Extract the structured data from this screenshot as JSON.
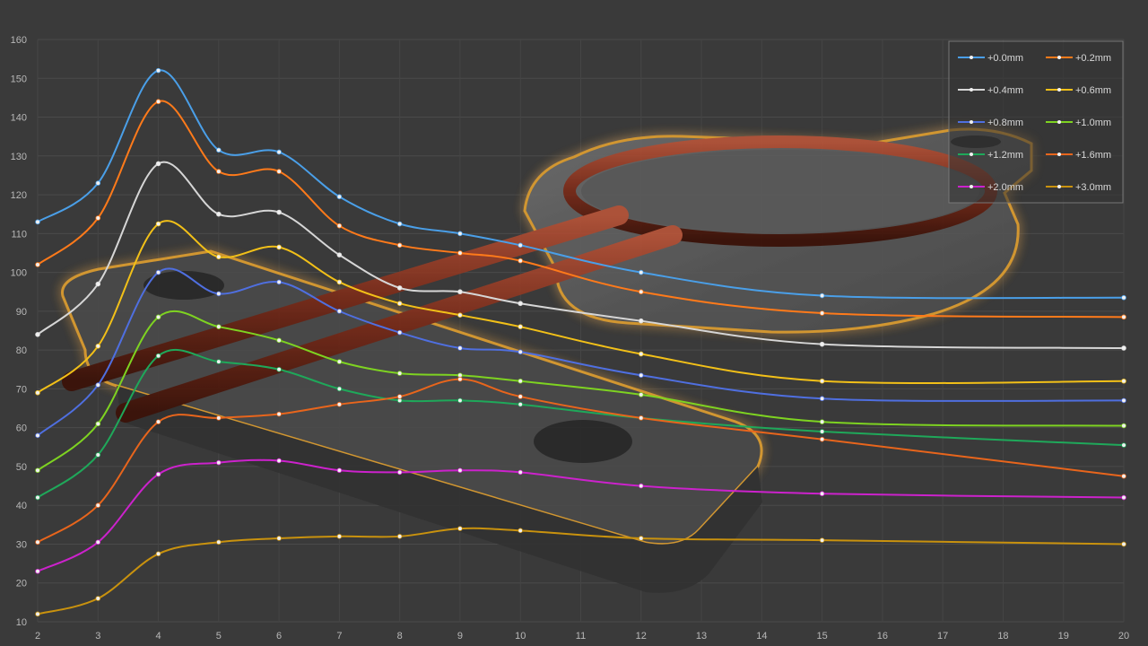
{
  "chart_data": {
    "type": "line",
    "x": [
      2,
      3,
      4,
      5,
      6,
      7,
      8,
      9,
      10,
      11,
      12,
      13,
      14,
      15,
      16,
      17,
      18,
      19,
      20
    ],
    "ylim": [
      10,
      160
    ],
    "xlim": [
      2,
      20
    ],
    "yticks": [
      10,
      20,
      30,
      40,
      50,
      60,
      70,
      80,
      90,
      100,
      110,
      120,
      130,
      140,
      150,
      160
    ],
    "xticks": [
      2,
      3,
      4,
      5,
      6,
      7,
      8,
      9,
      10,
      11,
      12,
      13,
      14,
      15,
      16,
      17,
      18,
      19,
      20
    ],
    "grid": true,
    "legend_position": "top-right",
    "series": [
      {
        "name": "+0.0mm",
        "color": "#4a9fe8",
        "x": [
          2,
          3,
          4,
          5,
          6,
          7,
          8,
          9,
          10,
          12,
          15,
          20
        ],
        "values": [
          113,
          123,
          152,
          131.5,
          131,
          119.5,
          112.5,
          110,
          107,
          100,
          94,
          93.5
        ]
      },
      {
        "name": "+0.2mm",
        "color": "#ff7a1a",
        "x": [
          2,
          3,
          4,
          5,
          6,
          7,
          8,
          9,
          10,
          12,
          15,
          20
        ],
        "values": [
          102,
          114,
          144,
          126,
          126,
          112,
          107,
          105,
          103,
          95,
          89.5,
          88.5
        ]
      },
      {
        "name": "+0.4mm",
        "color": "#d6d6d6",
        "x": [
          2,
          3,
          4,
          5,
          6,
          7,
          8,
          9,
          10,
          12,
          15,
          20
        ],
        "values": [
          84,
          97,
          128,
          115,
          115.5,
          104.5,
          96,
          95,
          92,
          87.5,
          81.5,
          80.5
        ]
      },
      {
        "name": "+0.6mm",
        "color": "#f2c018",
        "x": [
          2,
          3,
          4,
          5,
          6,
          7,
          8,
          9,
          10,
          12,
          15,
          20
        ],
        "values": [
          69,
          81,
          112.5,
          104,
          106.5,
          97.5,
          92,
          89,
          86,
          79,
          72,
          72
        ]
      },
      {
        "name": "+0.8mm",
        "color": "#4f6fe0",
        "x": [
          2,
          3,
          4,
          5,
          6,
          7,
          8,
          9,
          10,
          12,
          15,
          20
        ],
        "values": [
          58,
          71,
          100,
          94.5,
          97.5,
          90,
          84.5,
          80.5,
          79.5,
          73.5,
          67.5,
          67
        ]
      },
      {
        "name": "+1.0mm",
        "color": "#7ed321",
        "x": [
          2,
          3,
          4,
          5,
          6,
          7,
          8,
          9,
          10,
          12,
          15,
          20
        ],
        "values": [
          49,
          61,
          88.5,
          86,
          82.5,
          77,
          74,
          73.5,
          72,
          68.5,
          61.5,
          60.5
        ]
      },
      {
        "name": "+1.2mm",
        "color": "#1fa85a",
        "x": [
          2,
          3,
          4,
          5,
          6,
          7,
          8,
          9,
          10,
          12,
          15,
          20
        ],
        "values": [
          42,
          53,
          78.5,
          77,
          75,
          70,
          67,
          67,
          66,
          62.5,
          59,
          55.5
        ]
      },
      {
        "name": "+1.6mm",
        "color": "#e8651c",
        "x": [
          2,
          3,
          4,
          5,
          6,
          7,
          8,
          9,
          10,
          12,
          15,
          20
        ],
        "values": [
          30.5,
          40,
          61.5,
          62.5,
          63.5,
          66,
          68,
          72.5,
          68,
          62.5,
          57,
          47.5
        ]
      },
      {
        "name": "+2.0mm",
        "color": "#cc22cc",
        "x": [
          2,
          3,
          4,
          5,
          6,
          7,
          8,
          9,
          10,
          12,
          15,
          20
        ],
        "values": [
          23,
          30.5,
          48,
          51,
          51.5,
          49,
          48.5,
          49,
          48.5,
          45,
          43,
          42
        ]
      },
      {
        "name": "+3.0mm",
        "color": "#c9920e",
        "x": [
          2,
          3,
          4,
          5,
          6,
          7,
          8,
          9,
          10,
          12,
          15,
          20
        ],
        "values": [
          12,
          16,
          27.5,
          30.5,
          31.5,
          32,
          32,
          34,
          33.5,
          31.5,
          31,
          30
        ]
      }
    ]
  }
}
